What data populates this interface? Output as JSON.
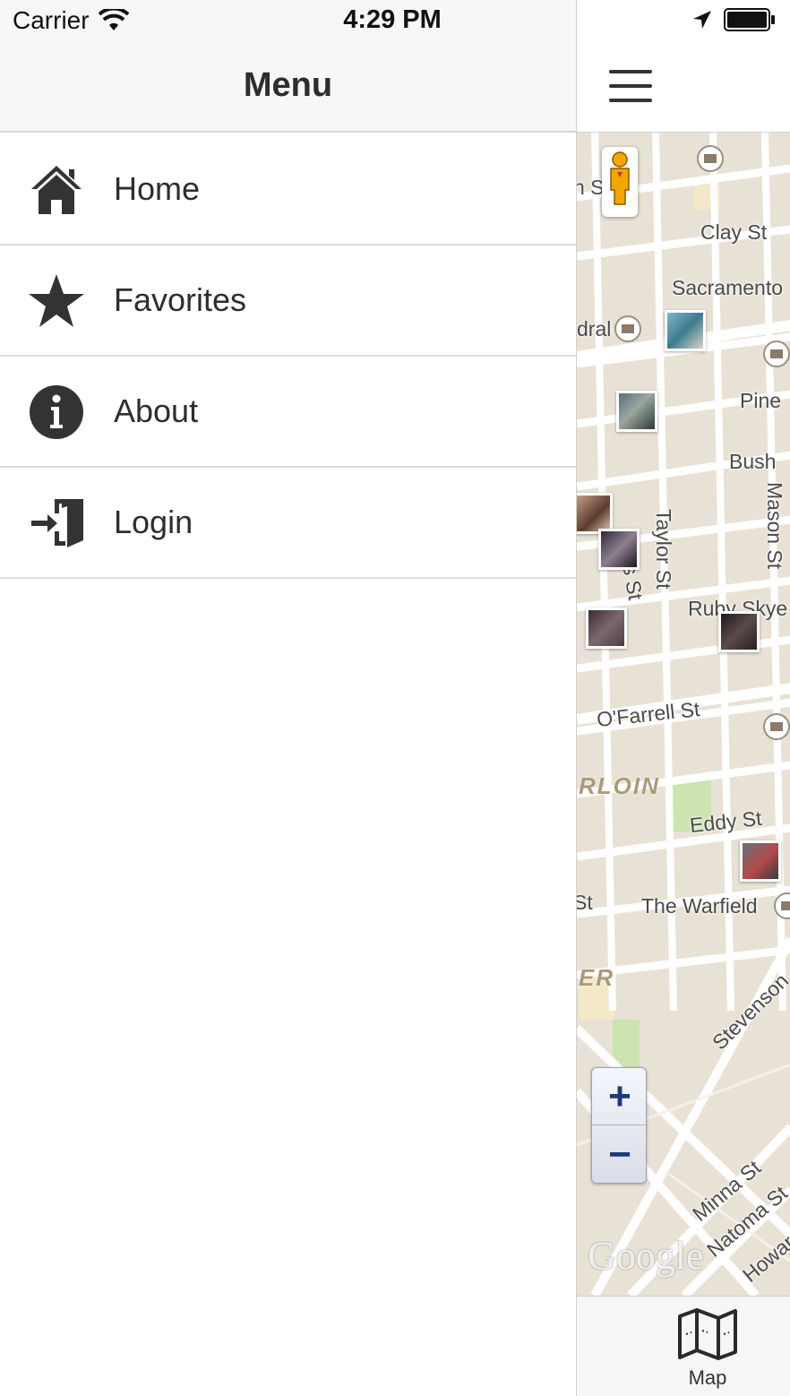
{
  "status_bar": {
    "carrier": "Carrier",
    "time": "4:29 PM"
  },
  "menu": {
    "title": "Menu",
    "items": [
      {
        "label": "Home",
        "icon": "home-icon"
      },
      {
        "label": "Favorites",
        "icon": "star-icon"
      },
      {
        "label": "About",
        "icon": "info-icon"
      },
      {
        "label": "Login",
        "icon": "login-icon"
      }
    ]
  },
  "map": {
    "street_labels": [
      "n St",
      "Clay St",
      "Sacramento",
      "dral",
      "Pine",
      "Bush",
      "Taylor St",
      "Mason St",
      "s St",
      "Ruby Skye",
      "O'Farrell St",
      "Eddy St",
      "St",
      "The Warfield",
      "Stevenson",
      "Minna St",
      "Natoma St",
      "Howard"
    ],
    "district_labels": [
      "RLOIN",
      "ER"
    ],
    "zoom_in": "+",
    "zoom_out": "−",
    "google_text": "Google"
  },
  "tabbar": {
    "map_label": "Map",
    "map_icon": "map-icon"
  }
}
